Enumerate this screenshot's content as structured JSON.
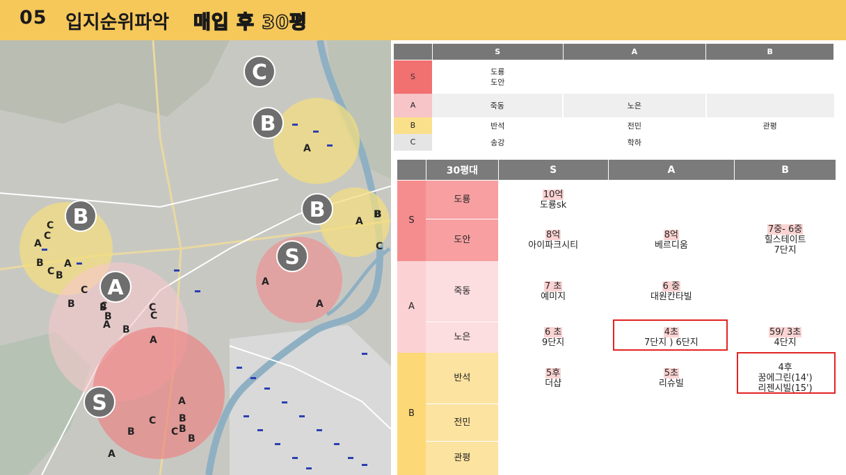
{
  "header": {
    "number": "05",
    "title": "입지순위파악",
    "subtitle": "매입 후 30평"
  },
  "map": {
    "zone_labels": [
      "C",
      "B",
      "B",
      "B",
      "S",
      "A",
      "S"
    ],
    "pins": [
      "A",
      "A",
      "B",
      "C",
      "C",
      "C",
      "A",
      "B",
      "A",
      "C",
      "B",
      "C",
      "B",
      "B",
      "C",
      "B",
      "A",
      "A",
      "B",
      "C",
      "A",
      "A",
      "C",
      "A",
      "B",
      "C",
      "B",
      "B",
      "A",
      "B",
      "C",
      "B"
    ]
  },
  "grade_table": {
    "headers": [
      "",
      "S",
      "A",
      "B"
    ],
    "rows": [
      {
        "grade": "S",
        "s": [
          "도룡",
          "도안"
        ],
        "a": "",
        "b": ""
      },
      {
        "grade": "A",
        "s": "죽동",
        "a": "노은",
        "b": ""
      },
      {
        "grade": "B",
        "s": "반석",
        "a": "전민",
        "b": "관평"
      },
      {
        "grade": "C",
        "s": "송강",
        "a": "학하",
        "b": ""
      }
    ]
  },
  "price_table": {
    "headers": [
      "",
      "30평대",
      "S",
      "A",
      "B"
    ],
    "groups": [
      {
        "grade": "S",
        "rows": [
          {
            "area": "도룡",
            "s_price": "10억",
            "s_name": "도룡sk",
            "a_price": "",
            "a_name": "",
            "b_price": "",
            "b_name": ""
          },
          {
            "area": "도안",
            "s_price": "8억",
            "s_name": "아이파크시티",
            "a_price": "8억",
            "a_name": "베르디움",
            "b_price": "7중- 6중",
            "b_name": "힐스테이트",
            "b_name2": "7단지"
          }
        ]
      },
      {
        "grade": "A",
        "rows": [
          {
            "area": "죽동",
            "s_price": "7 초",
            "s_name": "예미지",
            "a_price": "6 중",
            "a_name": "대원칸타빌",
            "b_price": "",
            "b_name": ""
          },
          {
            "area": "노은",
            "s_price": "6 초",
            "s_name": "9단지",
            "a_price": "4초",
            "a_name": "7단지 ) 6단지",
            "b_price": "59/ 3초",
            "b_name": "4단지"
          }
        ]
      },
      {
        "grade": "B",
        "rows": [
          {
            "area": "반석",
            "s_price": "5후",
            "s_name": "더샵",
            "a_price": "5초",
            "a_name": "리슈빌",
            "b_price": "4후",
            "b_name": "꿈에그린(14')",
            "b_name2": "리젠시빌(15')"
          },
          {
            "area": "전민",
            "s_price": "",
            "s_name": "",
            "a_price": "",
            "a_name": "",
            "b_price": "",
            "b_name": ""
          },
          {
            "area": "관평",
            "s_price": "",
            "s_name": "",
            "a_price": "",
            "a_name": "",
            "b_price": "",
            "b_name": ""
          }
        ]
      }
    ]
  },
  "colors": {
    "header_bg": "#f6c85a",
    "zone_S": "#f17070",
    "zone_A": "#f7c4c8",
    "zone_B": "#fbe08c",
    "zone_C": "#e5e5e5",
    "highlight_box": "#e22222"
  }
}
